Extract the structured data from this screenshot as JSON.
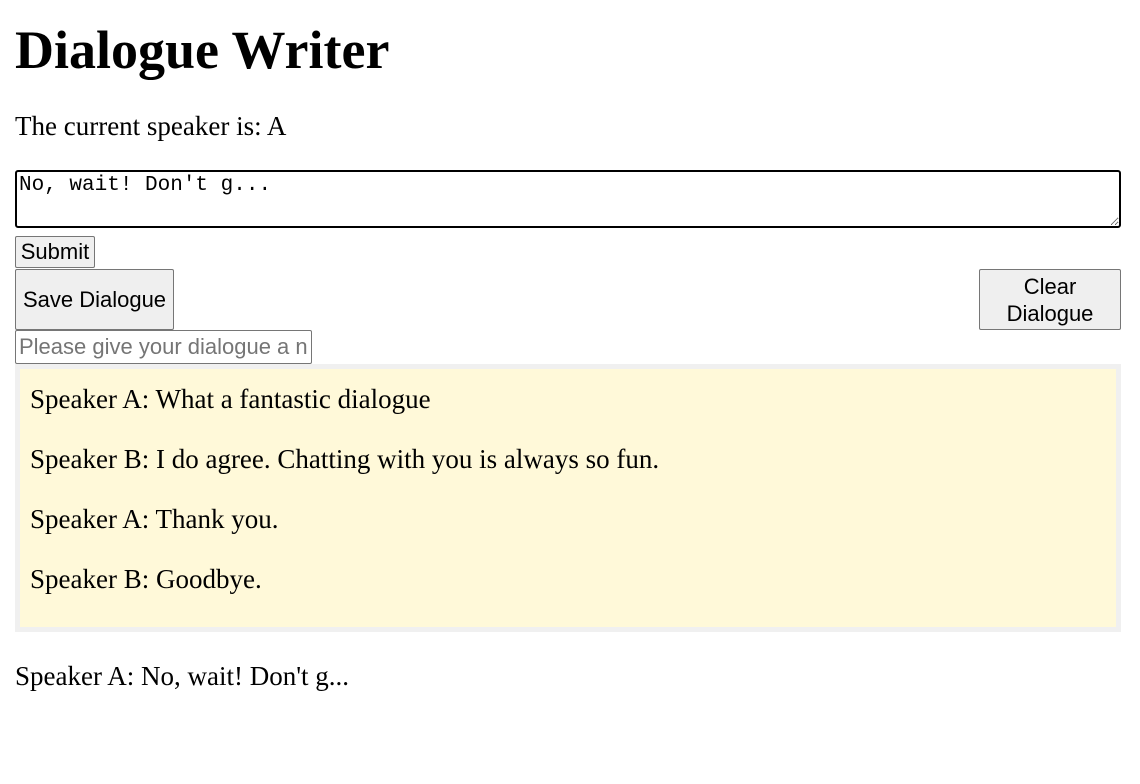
{
  "header": {
    "title": "Dialogue Writer"
  },
  "speaker": {
    "prefix": "The current speaker is: ",
    "current": "A"
  },
  "entry": {
    "value": "No, wait! Don't g..."
  },
  "buttons": {
    "submit_label": "Submit",
    "save_label": "Save Dialogue",
    "clear_label": "Clear Dialogue"
  },
  "name_input": {
    "placeholder": "Please give your dialogue a name",
    "value": ""
  },
  "dialogue": {
    "lines": [
      "Speaker A: What a fantastic dialogue",
      "Speaker B: I do agree. Chatting with you is always so fun.",
      "Speaker A: Thank you.",
      "Speaker B: Goodbye."
    ]
  },
  "current_line": {
    "text": "Speaker A: No, wait! Don't g..."
  },
  "colors": {
    "dialogue_background": "#fff9d9",
    "dialogue_border": "#f0f0f0",
    "button_background": "#efefef"
  }
}
